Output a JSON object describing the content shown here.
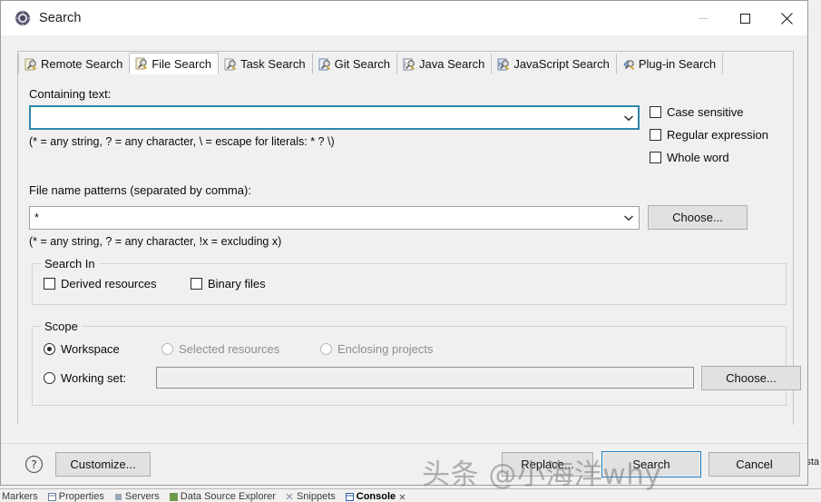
{
  "window": {
    "title": "Search",
    "icon": "search-app-icon",
    "controls": [
      {
        "name": "minimize-button",
        "glyph": "minimize-icon",
        "disabled": true
      },
      {
        "name": "maximize-button",
        "glyph": "maximize-icon",
        "disabled": false
      },
      {
        "name": "close-button",
        "glyph": "close-icon",
        "disabled": false
      }
    ]
  },
  "tabs": [
    {
      "label": "Remote Search",
      "icon": "search-page-icon",
      "active": false
    },
    {
      "label": "File Search",
      "icon": "file-search-icon",
      "active": true
    },
    {
      "label": "Task Search",
      "icon": "task-search-icon",
      "active": false
    },
    {
      "label": "Git Search",
      "icon": "git-search-icon",
      "active": false
    },
    {
      "label": "Java Search",
      "icon": "java-search-icon",
      "active": false
    },
    {
      "label": "JavaScript Search",
      "icon": "javascript-search-icon",
      "active": false
    },
    {
      "label": "Plug-in Search",
      "icon": "plugin-search-icon",
      "active": false
    }
  ],
  "file_search": {
    "containing_text_label": "Containing text:",
    "containing_text_value": "",
    "containing_text_hint": "(* = any string, ? = any character, \\ = escape for literals: * ? \\)",
    "options": [
      {
        "label": "Case sensitive",
        "checked": false,
        "name": "case-sensitive-checkbox"
      },
      {
        "label": "Regular expression",
        "checked": false,
        "name": "regular-expression-checkbox"
      },
      {
        "label": "Whole word",
        "checked": false,
        "name": "whole-word-checkbox"
      }
    ],
    "file_patterns_label": "File name patterns (separated by comma):",
    "file_patterns_value": "*",
    "file_patterns_hint": "(* = any string, ? = any character, !x = excluding x)",
    "choose_patterns_label": "Choose...",
    "search_in": {
      "title": "Search In",
      "options": [
        {
          "label": "Derived resources",
          "checked": false,
          "name": "derived-resources-checkbox"
        },
        {
          "label": "Binary files",
          "checked": false,
          "name": "binary-files-checkbox"
        }
      ]
    },
    "scope": {
      "title": "Scope",
      "options": [
        {
          "label": "Workspace",
          "checked": true,
          "disabled": false,
          "name": "scope-workspace-radio"
        },
        {
          "label": "Selected resources",
          "checked": false,
          "disabled": true,
          "name": "scope-selected-resources-radio"
        },
        {
          "label": "Enclosing projects",
          "checked": false,
          "disabled": true,
          "name": "scope-enclosing-projects-radio"
        },
        {
          "label": "Working set:",
          "checked": false,
          "disabled": false,
          "name": "scope-working-set-radio"
        }
      ],
      "working_set_value": "",
      "choose_working_set_label": "Choose..."
    }
  },
  "footer": {
    "help_icon": "help-icon",
    "customize_label": "Customize...",
    "replace_label": "Replace...",
    "search_label": "Search",
    "cancel_label": "Cancel"
  },
  "watermark": "头条 @小海洋why",
  "workbench": {
    "right_edge_text": "sta",
    "bottom_tabs": [
      {
        "label": "Markers",
        "active": false,
        "icon": "markers-icon"
      },
      {
        "label": "Properties",
        "active": false,
        "icon": "properties-icon"
      },
      {
        "label": "Servers",
        "active": false,
        "icon": "servers-icon"
      },
      {
        "label": "Data Source Explorer",
        "active": false,
        "icon": "datasource-icon"
      },
      {
        "label": "Snippets",
        "active": false,
        "icon": "snippets-icon"
      },
      {
        "label": "Console",
        "active": true,
        "icon": "console-icon"
      }
    ]
  },
  "colors": {
    "dialog_bg": "#f0f0f0",
    "focus_border": "#2e87a8",
    "default_button_border": "#1d7ec4",
    "title_bar": "#ffffff"
  }
}
